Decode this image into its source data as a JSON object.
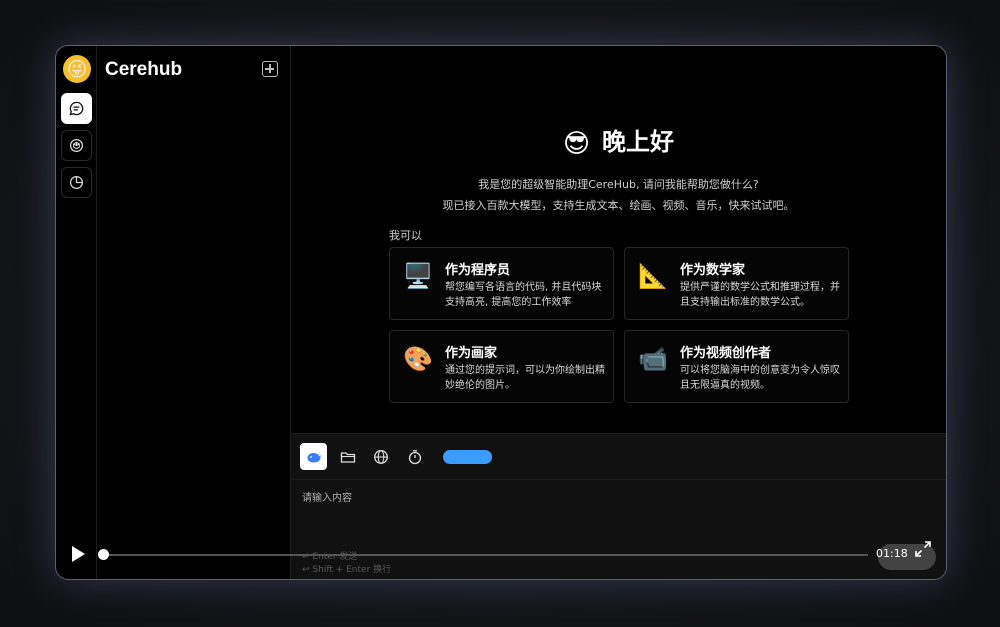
{
  "app": {
    "brand": "Cerehub",
    "logo_emoji": "😜"
  },
  "rail": {
    "items": [
      {
        "name": "chat",
        "icon": "chat-icon",
        "active": true
      },
      {
        "name": "models",
        "icon": "cube-icon",
        "active": false
      },
      {
        "name": "stats",
        "icon": "pie-icon",
        "active": false
      }
    ]
  },
  "welcome": {
    "emoji": "😎",
    "greeting": "晚上好",
    "intro_line1": "我是您的超级智能助理CereHub, 请问我能帮助您做什么?",
    "intro_line2": "现已接入百款大模型，支持生成文本、绘画、视频、音乐，快来试试吧。",
    "can_label": "我可以"
  },
  "cards": [
    {
      "icon": "🖥️",
      "title": "作为程序员",
      "desc": "帮您编写各语言的代码, 并且代码块支持高亮, 提高您的工作效率"
    },
    {
      "icon": "📐",
      "title": "作为数学家",
      "desc": "提供严谨的数学公式和推理过程，并且支持输出标准的数学公式。"
    },
    {
      "icon": "🎨",
      "title": "作为画家",
      "desc": "通过您的提示词，可以为你绘制出精妙绝伦的图片。"
    },
    {
      "icon": "📹",
      "title": "作为视频创作者",
      "desc": "可以将您脑海中的创意变为令人惊叹且无限逼真的视频。"
    }
  ],
  "composer": {
    "placeholder": "请输入内容",
    "hint_send": "↵ Enter 发送",
    "hint_newline": "↩ Shift + Enter 换行",
    "accent": "#3b9cff"
  },
  "video": {
    "time": "01:18",
    "progress": 0.0
  }
}
